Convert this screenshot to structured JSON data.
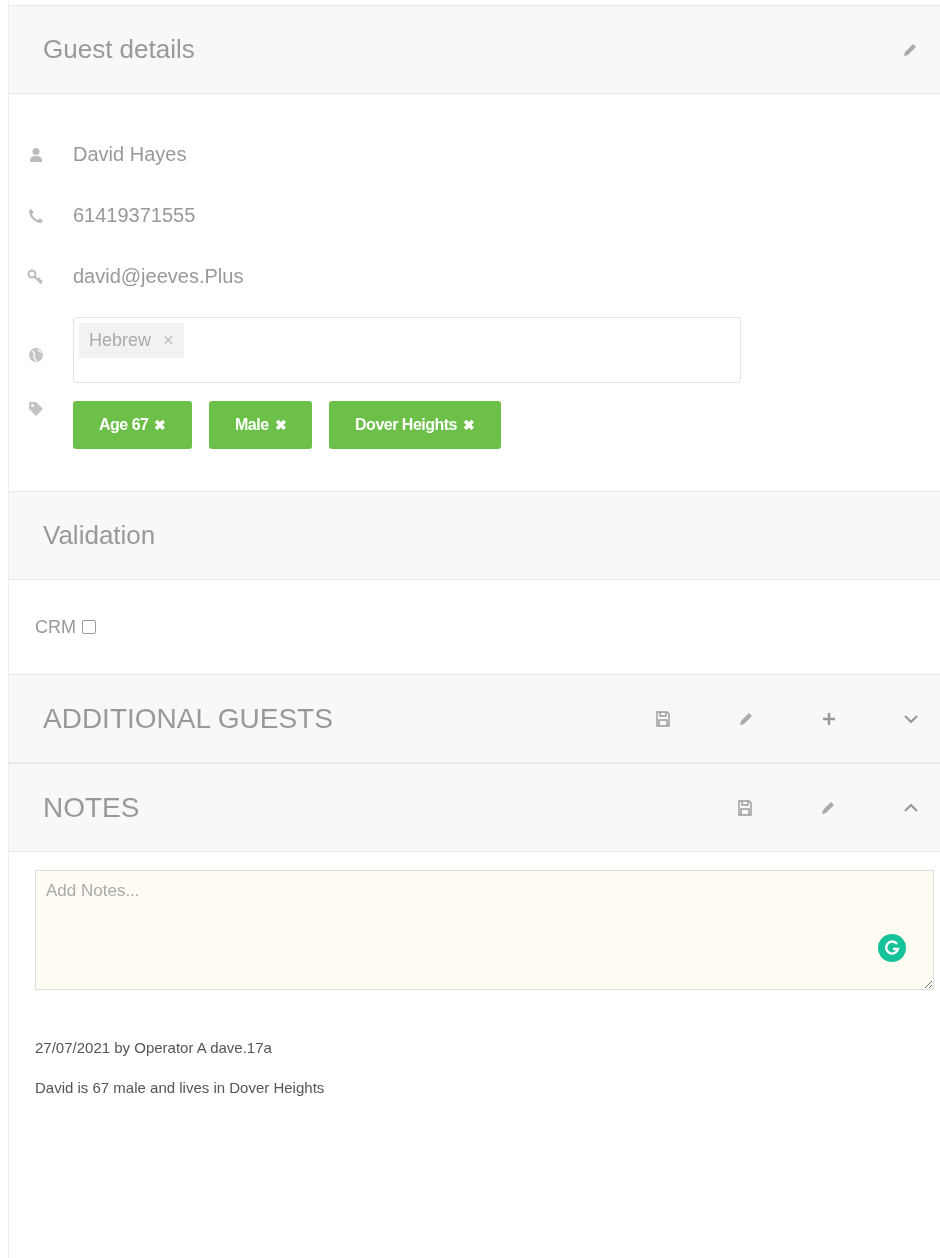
{
  "guest_details": {
    "title": "Guest details",
    "name": "David Hayes",
    "phone": "61419371555",
    "email": "david@jeeves.Plus",
    "languages": [
      {
        "label": "Hebrew",
        "remove": "×"
      }
    ],
    "tags": [
      {
        "label": "Age 67",
        "remove": "✖"
      },
      {
        "label": "Male",
        "remove": "✖"
      },
      {
        "label": "Dover Heights",
        "remove": "✖"
      }
    ]
  },
  "validation": {
    "title": "Validation",
    "crm": {
      "label": "CRM",
      "checked": false
    }
  },
  "additional_guests": {
    "title": "ADDITIONAL GUESTS",
    "expanded": false
  },
  "notes": {
    "title": "NOTES",
    "expanded": true,
    "placeholder": "Add Notes...",
    "entries": [
      {
        "meta": "27/07/2021 by Operator A dave.17a",
        "text": "David is 67 male and lives in Dover Heights"
      }
    ]
  }
}
